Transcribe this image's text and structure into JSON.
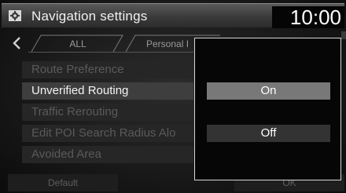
{
  "header": {
    "title": "Navigation settings",
    "clock": "10:00",
    "icon": "gear-icon"
  },
  "tabs": [
    {
      "label": "ALL"
    },
    {
      "label": "Personal I"
    }
  ],
  "list": [
    {
      "label": "Route Preference",
      "state": "dimmed"
    },
    {
      "label": "Unverified Routing",
      "state": "active"
    },
    {
      "label": "Traffic Rerouting",
      "state": "dimmed"
    },
    {
      "label": "Edit POI Search Radius Alo",
      "state": "dimmed"
    },
    {
      "label": "Avoided Area",
      "state": "dimmed"
    }
  ],
  "bottom": {
    "default_label": "Default",
    "ok_label": "OK"
  },
  "popup": {
    "options": [
      {
        "label": "On",
        "selected": true
      },
      {
        "label": "Off",
        "selected": false
      }
    ]
  },
  "colors": {
    "header": "#3a3a3a",
    "selected_option": "#787878",
    "unselected_option": "#333333",
    "active_item": "#3e3e3e",
    "dimmed_item": "#262626"
  }
}
